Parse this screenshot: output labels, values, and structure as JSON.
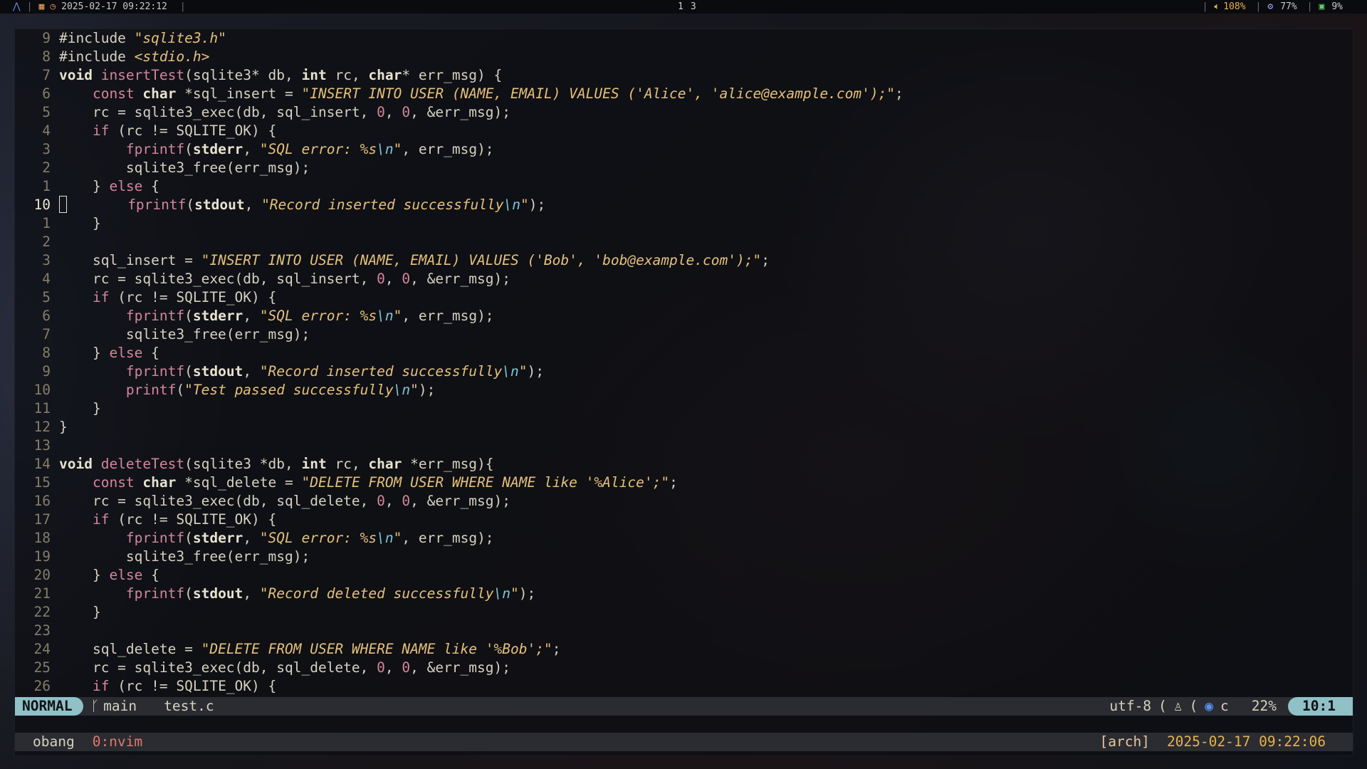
{
  "topbar": {
    "datetime": "2025-02-17 09:22:12",
    "workspaces": [
      "1",
      "3"
    ],
    "volume": "108%",
    "cpu": "77%",
    "memory": "9%"
  },
  "editor": {
    "lines": [
      {
        "ln": "9",
        "current": false,
        "tokens": [
          [
            "pp",
            "#include "
          ],
          [
            "inc",
            "\"sqlite3.h\""
          ]
        ]
      },
      {
        "ln": "8",
        "current": false,
        "tokens": [
          [
            "pp",
            "#include "
          ],
          [
            "inc",
            "<stdio.h>"
          ]
        ]
      },
      {
        "ln": "7",
        "current": false,
        "tokens": [
          [
            "ty",
            "void "
          ],
          [
            "fn",
            "insertTest"
          ],
          [
            "",
            "(sqlite3* db, "
          ],
          [
            "ty",
            "int"
          ],
          [
            "",
            " rc, "
          ],
          [
            "ty",
            "char"
          ],
          [
            "",
            "* err_msg) {"
          ]
        ]
      },
      {
        "ln": "6",
        "current": false,
        "tokens": [
          [
            "",
            "    "
          ],
          [
            "kw",
            "const "
          ],
          [
            "ty",
            "char"
          ],
          [
            "",
            " *sql_insert = "
          ],
          [
            "str",
            "\"INSERT INTO USER (NAME, EMAIL) VALUES ('Alice', 'alice@example.com');\""
          ],
          [
            "",
            ";"
          ]
        ]
      },
      {
        "ln": "5",
        "current": false,
        "tokens": [
          [
            "",
            "    rc = sqlite3_exec(db, sql_insert, "
          ],
          [
            "num",
            "0"
          ],
          [
            "",
            ", "
          ],
          [
            "num",
            "0"
          ],
          [
            "",
            ", &err_msg);"
          ]
        ]
      },
      {
        "ln": "4",
        "current": false,
        "tokens": [
          [
            "",
            "    "
          ],
          [
            "kw",
            "if"
          ],
          [
            "",
            " (rc != SQLITE_OK) {"
          ]
        ]
      },
      {
        "ln": "3",
        "current": false,
        "tokens": [
          [
            "",
            "        "
          ],
          [
            "fn",
            "fprintf"
          ],
          [
            "",
            "("
          ],
          [
            "ty",
            "stderr"
          ],
          [
            "",
            ", "
          ],
          [
            "str",
            "\"SQL error: %s"
          ],
          [
            "esc",
            "\\n"
          ],
          [
            "str",
            "\""
          ],
          [
            "",
            ", err_msg);"
          ]
        ]
      },
      {
        "ln": "2",
        "current": false,
        "tokens": [
          [
            "",
            "        sqlite3_free(err_msg);"
          ]
        ]
      },
      {
        "ln": "1",
        "current": false,
        "tokens": [
          [
            "",
            "    } "
          ],
          [
            "kw",
            "else"
          ],
          [
            "",
            " {"
          ]
        ]
      },
      {
        "ln": "10",
        "current": true,
        "tokens": [
          [
            "cursor",
            ""
          ],
          [
            "",
            "       "
          ],
          [
            "fn",
            "fprintf"
          ],
          [
            "",
            "("
          ],
          [
            "ty",
            "stdout"
          ],
          [
            "",
            ", "
          ],
          [
            "str",
            "\"Record inserted successfully"
          ],
          [
            "esc",
            "\\n"
          ],
          [
            "str",
            "\""
          ],
          [
            "",
            ");"
          ]
        ]
      },
      {
        "ln": "1",
        "current": false,
        "tokens": [
          [
            "",
            "    }"
          ]
        ]
      },
      {
        "ln": "2",
        "current": false,
        "tokens": [
          [
            "",
            ""
          ]
        ]
      },
      {
        "ln": "3",
        "current": false,
        "tokens": [
          [
            "",
            "    sql_insert = "
          ],
          [
            "str",
            "\"INSERT INTO USER (NAME, EMAIL) VALUES ('Bob', 'bob@example.com');\""
          ],
          [
            "",
            ";"
          ]
        ]
      },
      {
        "ln": "4",
        "current": false,
        "tokens": [
          [
            "",
            "    rc = sqlite3_exec(db, sql_insert, "
          ],
          [
            "num",
            "0"
          ],
          [
            "",
            ", "
          ],
          [
            "num",
            "0"
          ],
          [
            "",
            ", &err_msg);"
          ]
        ]
      },
      {
        "ln": "5",
        "current": false,
        "tokens": [
          [
            "",
            "    "
          ],
          [
            "kw",
            "if"
          ],
          [
            "",
            " (rc != SQLITE_OK) {"
          ]
        ]
      },
      {
        "ln": "6",
        "current": false,
        "tokens": [
          [
            "",
            "        "
          ],
          [
            "fn",
            "fprintf"
          ],
          [
            "",
            "("
          ],
          [
            "ty",
            "stderr"
          ],
          [
            "",
            ", "
          ],
          [
            "str",
            "\"SQL error: %s"
          ],
          [
            "esc",
            "\\n"
          ],
          [
            "str",
            "\""
          ],
          [
            "",
            ", err_msg);"
          ]
        ]
      },
      {
        "ln": "7",
        "current": false,
        "tokens": [
          [
            "",
            "        sqlite3_free(err_msg);"
          ]
        ]
      },
      {
        "ln": "8",
        "current": false,
        "tokens": [
          [
            "",
            "    } "
          ],
          [
            "kw",
            "else"
          ],
          [
            "",
            " {"
          ]
        ]
      },
      {
        "ln": "9",
        "current": false,
        "tokens": [
          [
            "",
            "        "
          ],
          [
            "fn",
            "fprintf"
          ],
          [
            "",
            "("
          ],
          [
            "ty",
            "stdout"
          ],
          [
            "",
            ", "
          ],
          [
            "str",
            "\"Record inserted successfully"
          ],
          [
            "esc",
            "\\n"
          ],
          [
            "str",
            "\""
          ],
          [
            "",
            ");"
          ]
        ]
      },
      {
        "ln": "10",
        "current": false,
        "tokens": [
          [
            "",
            "        "
          ],
          [
            "fn",
            "printf"
          ],
          [
            "",
            "("
          ],
          [
            "str",
            "\"Test passed successfully"
          ],
          [
            "esc",
            "\\n"
          ],
          [
            "str",
            "\""
          ],
          [
            "",
            ");"
          ]
        ]
      },
      {
        "ln": "11",
        "current": false,
        "tokens": [
          [
            "",
            "    }"
          ]
        ]
      },
      {
        "ln": "12",
        "current": false,
        "tokens": [
          [
            "",
            "}"
          ]
        ]
      },
      {
        "ln": "13",
        "current": false,
        "tokens": [
          [
            "",
            ""
          ]
        ]
      },
      {
        "ln": "14",
        "current": false,
        "tokens": [
          [
            "ty",
            "void "
          ],
          [
            "fn",
            "deleteTest"
          ],
          [
            "",
            "(sqlite3 *db, "
          ],
          [
            "ty",
            "int"
          ],
          [
            "",
            " rc, "
          ],
          [
            "ty",
            "char"
          ],
          [
            "",
            " *err_msg){"
          ]
        ]
      },
      {
        "ln": "15",
        "current": false,
        "tokens": [
          [
            "",
            "    "
          ],
          [
            "kw",
            "const "
          ],
          [
            "ty",
            "char"
          ],
          [
            "",
            " *sql_delete = "
          ],
          [
            "str",
            "\"DELETE FROM USER WHERE NAME like '%Alice';\""
          ],
          [
            "",
            ";"
          ]
        ]
      },
      {
        "ln": "16",
        "current": false,
        "tokens": [
          [
            "",
            "    rc = sqlite3_exec(db, sql_delete, "
          ],
          [
            "num",
            "0"
          ],
          [
            "",
            ", "
          ],
          [
            "num",
            "0"
          ],
          [
            "",
            ", &err_msg);"
          ]
        ]
      },
      {
        "ln": "17",
        "current": false,
        "tokens": [
          [
            "",
            "    "
          ],
          [
            "kw",
            "if"
          ],
          [
            "",
            " (rc != SQLITE_OK) {"
          ]
        ]
      },
      {
        "ln": "18",
        "current": false,
        "tokens": [
          [
            "",
            "        "
          ],
          [
            "fn",
            "fprintf"
          ],
          [
            "",
            "("
          ],
          [
            "ty",
            "stderr"
          ],
          [
            "",
            ", "
          ],
          [
            "str",
            "\"SQL error: %s"
          ],
          [
            "esc",
            "\\n"
          ],
          [
            "str",
            "\""
          ],
          [
            "",
            ", err_msg);"
          ]
        ]
      },
      {
        "ln": "19",
        "current": false,
        "tokens": [
          [
            "",
            "        sqlite3_free(err_msg);"
          ]
        ]
      },
      {
        "ln": "20",
        "current": false,
        "tokens": [
          [
            "",
            "    } "
          ],
          [
            "kw",
            "else"
          ],
          [
            "",
            " {"
          ]
        ]
      },
      {
        "ln": "21",
        "current": false,
        "tokens": [
          [
            "",
            "        "
          ],
          [
            "fn",
            "fprintf"
          ],
          [
            "",
            "("
          ],
          [
            "ty",
            "stdout"
          ],
          [
            "",
            ", "
          ],
          [
            "str",
            "\"Record deleted successfully"
          ],
          [
            "esc",
            "\\n"
          ],
          [
            "str",
            "\""
          ],
          [
            "",
            ");"
          ]
        ]
      },
      {
        "ln": "22",
        "current": false,
        "tokens": [
          [
            "",
            "    }"
          ]
        ]
      },
      {
        "ln": "23",
        "current": false,
        "tokens": [
          [
            "",
            ""
          ]
        ]
      },
      {
        "ln": "24",
        "current": false,
        "tokens": [
          [
            "",
            "    sql_delete = "
          ],
          [
            "str",
            "\"DELETE FROM USER WHERE NAME like '%Bob';\""
          ],
          [
            "",
            ";"
          ]
        ]
      },
      {
        "ln": "25",
        "current": false,
        "tokens": [
          [
            "",
            "    rc = sqlite3_exec(db, sql_delete, "
          ],
          [
            "num",
            "0"
          ],
          [
            "",
            ", "
          ],
          [
            "num",
            "0"
          ],
          [
            "",
            ", &err_msg);"
          ]
        ]
      },
      {
        "ln": "26",
        "current": false,
        "tokens": [
          [
            "",
            "    "
          ],
          [
            "kw",
            "if"
          ],
          [
            "",
            " (rc != SQLITE_OK) {"
          ]
        ]
      }
    ]
  },
  "statusline": {
    "mode": "NORMAL",
    "branch_icon": "ᚴ",
    "branch": "main",
    "filename": "test.c",
    "encoding": "utf-8",
    "filetype": "c",
    "percent": "22%",
    "position": "10:1"
  },
  "tmux": {
    "session": "obang",
    "window": "0:nvim",
    "host": "[arch]",
    "datetime": "2025-02-17 09:22:06"
  }
}
